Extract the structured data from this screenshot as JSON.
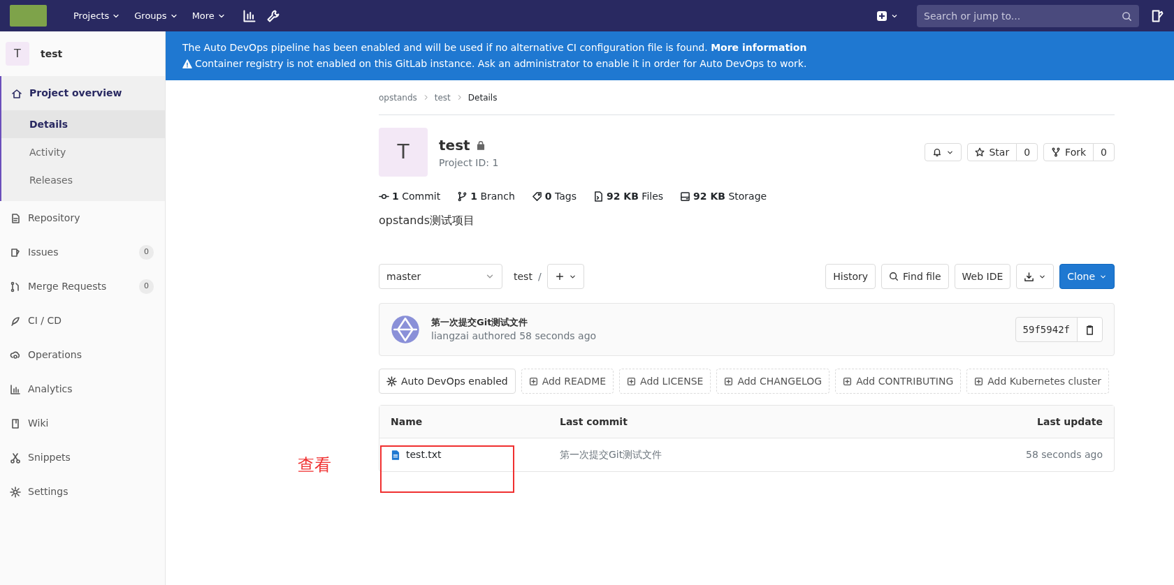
{
  "topbar": {
    "nav": [
      {
        "label": "Projects"
      },
      {
        "label": "Groups"
      },
      {
        "label": "More"
      }
    ],
    "search": {
      "placeholder": "Search or jump to..."
    }
  },
  "banner": {
    "message": "The Auto DevOps pipeline has been enabled and will be used if no alternative CI configuration file is found.",
    "link": "More information",
    "warning": "Container registry is not enabled on this GitLab instance. Ask an administrator to enable it in order for Auto DevOps to work."
  },
  "sidebar": {
    "project": {
      "avatar": "T",
      "name": "test"
    },
    "items": [
      {
        "label": "Project overview",
        "selected": true,
        "children": [
          {
            "label": "Details",
            "selected": true
          },
          {
            "label": "Activity",
            "selected": false
          },
          {
            "label": "Releases",
            "selected": false
          }
        ]
      },
      {
        "label": "Repository",
        "selected": false
      },
      {
        "label": "Issues",
        "selected": false,
        "count": "0"
      },
      {
        "label": "Merge Requests",
        "selected": false,
        "count": "0"
      },
      {
        "label": "CI / CD",
        "selected": false
      },
      {
        "label": "Operations",
        "selected": false
      },
      {
        "label": "Analytics",
        "selected": false
      },
      {
        "label": "Wiki",
        "selected": false
      },
      {
        "label": "Snippets",
        "selected": false
      },
      {
        "label": "Settings",
        "selected": false
      }
    ]
  },
  "breadcrumbs": [
    "opstands",
    "test",
    "Details"
  ],
  "project": {
    "avatar": "T",
    "name": "test",
    "id_text": "Project ID: 1",
    "star": {
      "label": "Star",
      "count": "0"
    },
    "fork": {
      "label": "Fork",
      "count": "0"
    }
  },
  "stats": [
    {
      "value": "1",
      "label": "Commit"
    },
    {
      "value": "1",
      "label": "Branch"
    },
    {
      "value": "0",
      "label": "Tags"
    },
    {
      "value": "92 KB",
      "label": "Files"
    },
    {
      "value": "92 KB",
      "label": "Storage"
    }
  ],
  "description": "opstands测试项目",
  "toolbar": {
    "branch": "master",
    "path": "test",
    "separator": "/",
    "buttons": [
      "History",
      "Find file",
      "Web IDE"
    ],
    "clone": "Clone"
  },
  "commit": {
    "title": "第一次提交Git测试文件",
    "author": "liangzai authored 58 seconds ago",
    "sha": "59f5942f"
  },
  "actions": [
    {
      "label": "Auto DevOps enabled",
      "kind": "setting"
    },
    {
      "label": "Add README",
      "kind": "add"
    },
    {
      "label": "Add LICENSE",
      "kind": "add"
    },
    {
      "label": "Add CHANGELOG",
      "kind": "add"
    },
    {
      "label": "Add CONTRIBUTING",
      "kind": "add"
    },
    {
      "label": "Add Kubernetes cluster",
      "kind": "add"
    }
  ],
  "table": {
    "columns": [
      "Name",
      "Last commit",
      "Last update"
    ],
    "rows": [
      {
        "name": "test.txt",
        "commit": "第一次提交Git测试文件",
        "updated": "58 seconds ago"
      }
    ]
  },
  "annotation": {
    "text": "查看"
  }
}
